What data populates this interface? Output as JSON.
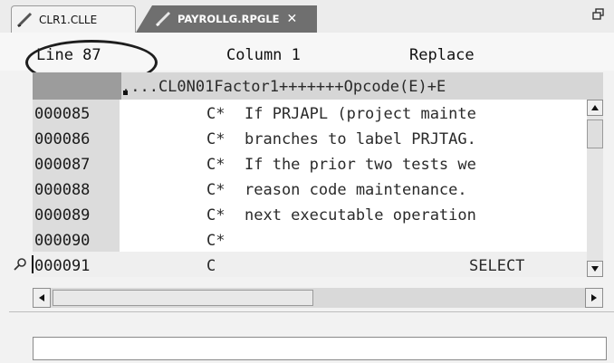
{
  "tabs": [
    {
      "label": "CLR1.CLLE",
      "icon": "pencil-icon",
      "active": false
    },
    {
      "label": "PAYROLLG.RPGLE",
      "icon": "pencil-icon",
      "active": true,
      "close": "✕"
    }
  ],
  "status": {
    "line": "Line 87",
    "column": "Column 1",
    "mode": "Replace"
  },
  "ruler": "....CL0N01Factor1+++++++Opcode(E)+E",
  "rows": [
    {
      "seq": "000085",
      "spec": "C*",
      "text": "If PRJAPL (project mainte"
    },
    {
      "seq": "000086",
      "spec": "C*",
      "text": "branches to label PRJTAG."
    },
    {
      "seq": "000087",
      "spec": "C*",
      "text": "If the prior two tests we"
    },
    {
      "seq": "000088",
      "spec": "C*",
      "text": "reason code maintenance."
    },
    {
      "seq": "000089",
      "spec": "C*",
      "text": "next executable operation"
    },
    {
      "seq": "000090",
      "spec": "C*",
      "text": ""
    },
    {
      "seq": "000091",
      "spec": "C",
      "text": "",
      "opcode": "SELECT"
    }
  ],
  "command_line": {
    "value": ""
  },
  "colors": {
    "active_tab": "#6f6f6f",
    "sequence_column": "#dcdcdc",
    "ruler": "#d6d6d6",
    "editor_bg": "#ffffff"
  }
}
